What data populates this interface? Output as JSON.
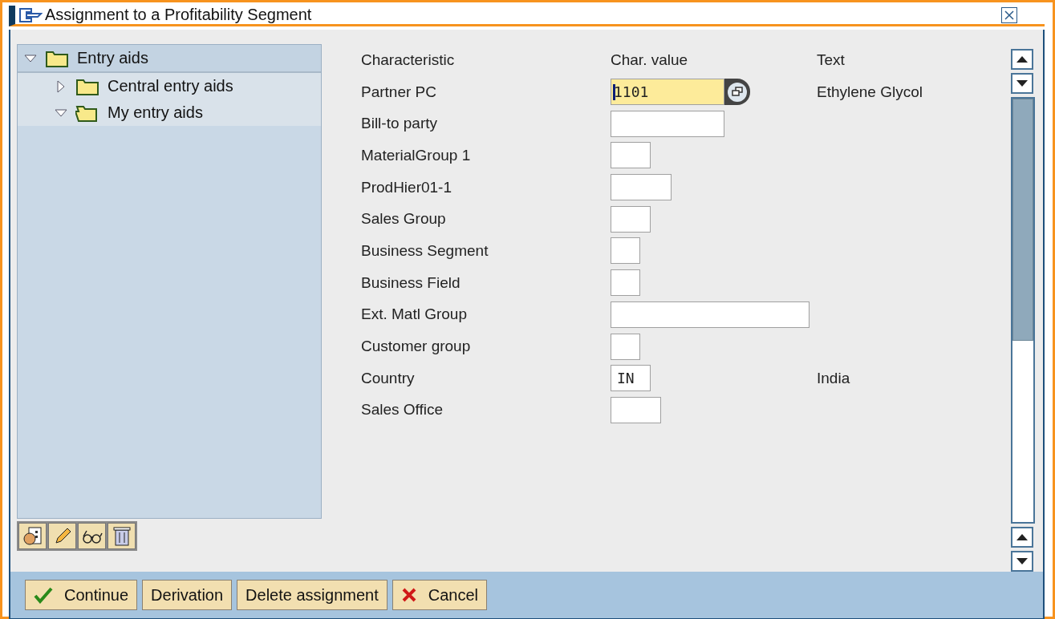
{
  "window": {
    "title": "Assignment to a Profitability Segment"
  },
  "tree": [
    {
      "label": "Entry aids",
      "expanded": true,
      "selected": true,
      "children": [
        {
          "label": "Central entry aids",
          "expanded": false,
          "selected": false
        },
        {
          "label": "My entry aids",
          "expanded": true,
          "selected": false
        }
      ]
    }
  ],
  "columns": [
    "Characteristic",
    "Char. value",
    "Text"
  ],
  "rows": [
    {
      "label": "Partner PC",
      "value": "1101",
      "kind": "medium",
      "focused": true,
      "text": "Ethylene Glycol"
    },
    {
      "label": "Bill-to party",
      "kind": "medium",
      "focused": false
    },
    {
      "label": "MaterialGroup 1",
      "kind": "small",
      "focused": false
    },
    {
      "label": "ProdHier01-1",
      "kind": "mid",
      "focused": false
    },
    {
      "label": "Sales Group",
      "kind": "small",
      "focused": false
    },
    {
      "label": "Business Segment",
      "kind": "tiny",
      "focused": false
    },
    {
      "label": "Business Field",
      "kind": "tiny",
      "focused": false
    },
    {
      "label": "Ext. Matl Group",
      "kind": "wide",
      "focused": false
    },
    {
      "label": "Customer group",
      "kind": "tiny",
      "focused": false
    },
    {
      "label": "Country",
      "value": "IN",
      "kind": "small",
      "focused": false,
      "text": "India"
    },
    {
      "label": "Sales Office",
      "kind": "short",
      "focused": false
    }
  ],
  "buttons": [
    {
      "label": "Continue",
      "kind": "ok"
    },
    {
      "label": "Derivation",
      "kind": "plain"
    },
    {
      "label": "Delete assignment",
      "kind": "plain"
    },
    {
      "label": "Cancel",
      "kind": "cancel"
    }
  ]
}
